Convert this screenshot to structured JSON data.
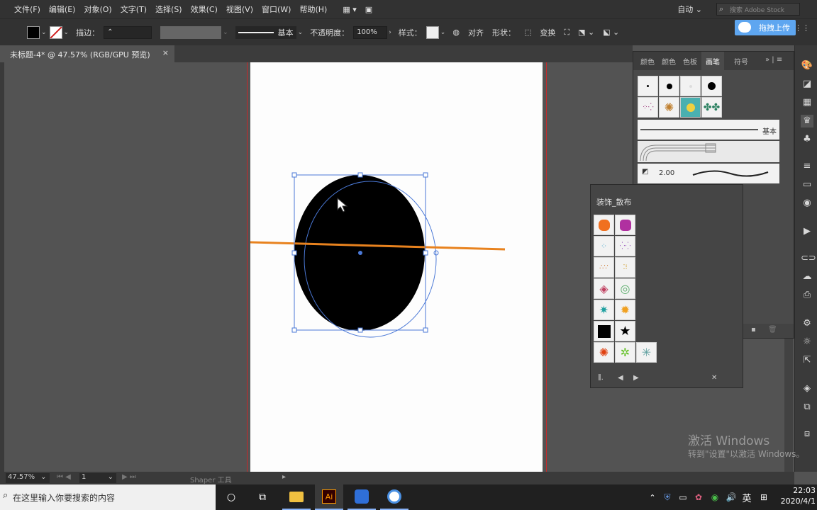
{
  "menu": {
    "items": [
      "文件(F)",
      "编辑(E)",
      "对象(O)",
      "文字(T)",
      "选择(S)",
      "效果(C)",
      "视图(V)",
      "窗口(W)",
      "帮助(H)"
    ],
    "workspace": "自动",
    "search_placeholder": "搜索 Adobe Stock"
  },
  "control": {
    "stroke_label": "描边：",
    "brush_label": "基本",
    "opacity_label": "不透明度：",
    "opacity_value": "100%",
    "style_label": "样式：",
    "align_label": "对齐",
    "shape_label": "形状：",
    "transform_label": "变换",
    "upload_label": "拖拽上传"
  },
  "document": {
    "tab_title": "未标题-4* @ 47.57% (RGB/GPU 预览)",
    "close": "×"
  },
  "brush_panel": {
    "tabs": [
      "颜色",
      "颜色",
      "色板",
      "画笔",
      "符号"
    ],
    "active_tab": "画笔",
    "basic_label": "基本",
    "stroke_value": "2.00"
  },
  "scatter_panel": {
    "title": "装饰_散布"
  },
  "status": {
    "zoom": "47.57%",
    "artboard_num": "1",
    "tool": "Shaper 工具"
  },
  "watermark": {
    "line1": "激活 Windows",
    "line2": "转到\"设置\"以激活 Windows。"
  },
  "taskbar": {
    "search_placeholder": "在这里输入你要搜索的内容",
    "ime": "英",
    "time": "22:03",
    "date": "2020/4/1"
  },
  "colors": {
    "accent_orange": "#e8821e",
    "selection_blue": "#4a78d6",
    "bleed_red": "#c7292b",
    "upload_blue": "#5ea6f0"
  }
}
